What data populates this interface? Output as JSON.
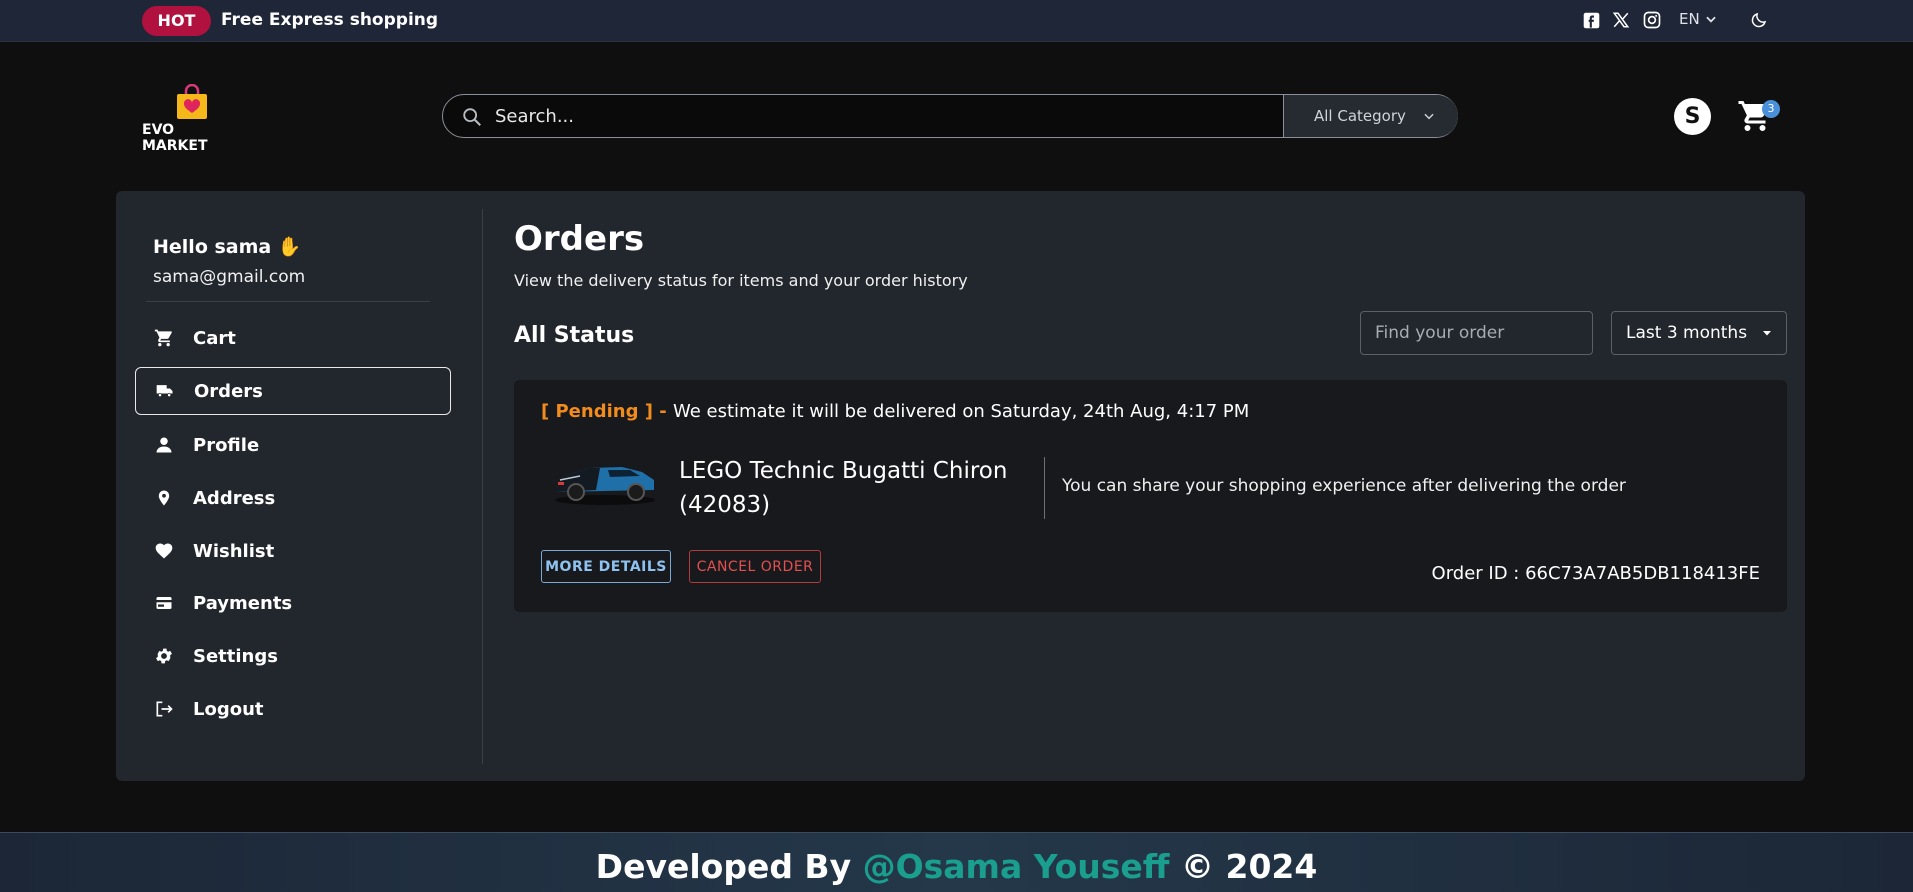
{
  "topbar": {
    "hot_badge": "HOT",
    "promo": "Free Express shopping",
    "language": "EN",
    "icons": [
      "facebook-icon",
      "x-icon",
      "instagram-icon",
      "moon-icon"
    ]
  },
  "header": {
    "logo_text": "EVO MARKET",
    "search_placeholder": "Search...",
    "category": "All Category",
    "avatar_initial": "S",
    "cart_count": "3"
  },
  "sidebar": {
    "greeting": "Hello sama ✋",
    "email": "sama@gmail.com",
    "items": [
      {
        "label": "Cart",
        "icon": "cart-icon"
      },
      {
        "label": "Orders",
        "icon": "truck-icon",
        "active": true
      },
      {
        "label": "Profile",
        "icon": "person-icon"
      },
      {
        "label": "Address",
        "icon": "location-pin-icon"
      },
      {
        "label": "Wishlist",
        "icon": "heart-icon"
      },
      {
        "label": "Payments",
        "icon": "credit-card-icon"
      },
      {
        "label": "Settings",
        "icon": "gear-icon"
      },
      {
        "label": "Logout",
        "icon": "logout-icon"
      }
    ]
  },
  "orders": {
    "title": "Orders",
    "subtitle": "View the delivery status for items and your order history",
    "status_title": "All Status",
    "find_placeholder": "Find your order",
    "period": "Last 3 months",
    "order": {
      "status": "[ Pending ]",
      "dash": " - ",
      "estimate": "We estimate it will be delivered on Saturday, 24th Aug, 4:17 PM",
      "product_name": "LEGO Technic Bugatti Chiron (42083)",
      "share_note": "You can share your shopping experience after delivering the order",
      "more_details": "MORE DETAILS",
      "cancel": "CANCEL ORDER",
      "order_id": "Order ID : 66C73A7AB5DB118413FE"
    }
  },
  "footer": {
    "prefix": "Developed By ",
    "author": "@Osama Youseff",
    "suffix": " © 2024"
  },
  "colors": {
    "accent_hot": "#b0113f",
    "pending": "#f28c1c",
    "link": "#1a9e8d",
    "more_details": "#90c2f0",
    "cancel": "#e3504f"
  }
}
